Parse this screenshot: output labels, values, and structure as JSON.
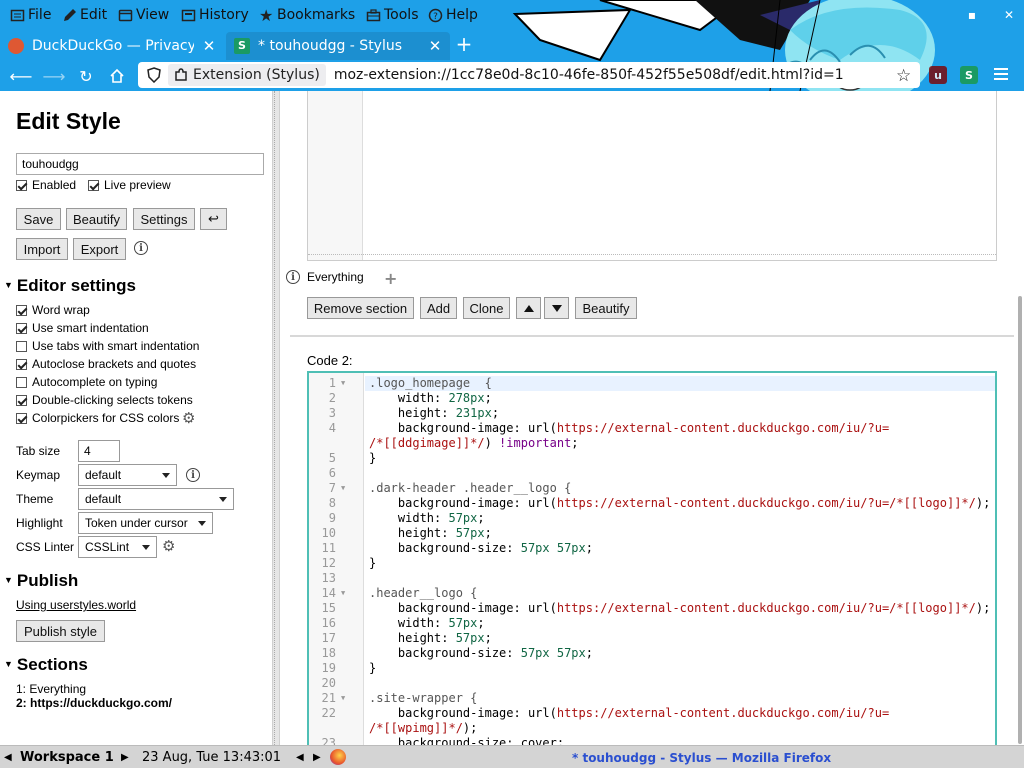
{
  "menubar": {
    "items": [
      "File",
      "Edit",
      "View",
      "History",
      "Bookmarks",
      "Tools",
      "Help"
    ]
  },
  "tabs": [
    {
      "title": "DuckDuckGo — Privacy, simplified.",
      "active": false
    },
    {
      "title": "* touhoudgg - Stylus",
      "active": true
    }
  ],
  "nav": {
    "identity_label": "Extension (Stylus)",
    "url": "moz-extension://1cc78e0d-8c10-46fe-850f-452f55e508df/edit.html?id=1"
  },
  "sidebar": {
    "title": "Edit Style",
    "style_name": "touhoudgg",
    "enabled_label": "Enabled",
    "live_preview_label": "Live preview",
    "buttons": {
      "save": "Save",
      "beautify": "Beautify",
      "settings": "Settings",
      "undo": "↩",
      "import": "Import",
      "export": "Export"
    },
    "editor_settings": {
      "heading": "Editor settings",
      "options": [
        {
          "label": "Word wrap",
          "checked": true
        },
        {
          "label": "Use smart indentation",
          "checked": true
        },
        {
          "label": "Use tabs with smart indentation",
          "checked": false
        },
        {
          "label": "Autoclose brackets and quotes",
          "checked": true
        },
        {
          "label": "Autocomplete on typing",
          "checked": false
        },
        {
          "label": "Double-clicking selects tokens",
          "checked": true
        },
        {
          "label": "Colorpickers for CSS colors",
          "checked": true
        }
      ],
      "tab_size_label": "Tab size",
      "tab_size": "4",
      "keymap_label": "Keymap",
      "keymap": "default",
      "theme_label": "Theme",
      "theme": "default",
      "highlight_label": "Highlight",
      "highlight": "Token under cursor",
      "linter_label": "CSS Linter",
      "linter": "CSSLint"
    },
    "publish": {
      "heading": "Publish",
      "link": "Using userstyles.world",
      "button": "Publish style"
    },
    "sections": {
      "heading": "Sections",
      "items": [
        "1: Everything",
        "2: https://duckduckgo.com/"
      ]
    }
  },
  "main": {
    "applies_to": "Everything",
    "section_buttons": {
      "remove": "Remove section",
      "add": "Add",
      "clone": "Clone",
      "beautify": "Beautify"
    },
    "code_label": "Code 2:",
    "code_lines": [
      {
        "n": "1",
        "fold": true,
        "parts": [
          [
            "sel",
            ".logo_homepage  {"
          ]
        ]
      },
      {
        "n": "2",
        "fold": false,
        "parts": [
          [
            "",
            "    width: "
          ],
          [
            "n",
            "278px"
          ],
          [
            "",
            ";"
          ]
        ]
      },
      {
        "n": "3",
        "fold": false,
        "parts": [
          [
            "",
            "    height: "
          ],
          [
            "n",
            "231px"
          ],
          [
            "",
            ";"
          ]
        ]
      },
      {
        "n": "4",
        "fold": false,
        "parts": [
          [
            "",
            "    background-image: url("
          ],
          [
            "s",
            "https://external-content.duckduckgo.com/iu/?u="
          ]
        ]
      },
      {
        "n": "",
        "fold": false,
        "parts": [
          [
            "s",
            "/*[[ddgimage]]*/"
          ],
          [
            "",
            ") "
          ],
          [
            "k",
            "!important"
          ],
          [
            "",
            ";"
          ]
        ]
      },
      {
        "n": "5",
        "fold": false,
        "parts": [
          [
            "",
            "}"
          ]
        ]
      },
      {
        "n": "6",
        "fold": false,
        "parts": [
          [
            "",
            ""
          ]
        ]
      },
      {
        "n": "7",
        "fold": true,
        "parts": [
          [
            "sel",
            ".dark-header .header__logo {"
          ]
        ]
      },
      {
        "n": "8",
        "fold": false,
        "parts": [
          [
            "",
            "    background-image: url("
          ],
          [
            "s",
            "https://external-content.duckduckgo.com/iu/?u=/*[[logo]]*/"
          ],
          [
            "",
            ");"
          ]
        ]
      },
      {
        "n": "9",
        "fold": false,
        "parts": [
          [
            "",
            "    width: "
          ],
          [
            "n",
            "57px"
          ],
          [
            "",
            ";"
          ]
        ]
      },
      {
        "n": "10",
        "fold": false,
        "parts": [
          [
            "",
            "    height: "
          ],
          [
            "n",
            "57px"
          ],
          [
            "",
            ";"
          ]
        ]
      },
      {
        "n": "11",
        "fold": false,
        "parts": [
          [
            "",
            "    background-size: "
          ],
          [
            "n",
            "57px 57px"
          ],
          [
            "",
            ";"
          ]
        ]
      },
      {
        "n": "12",
        "fold": false,
        "parts": [
          [
            "",
            "}"
          ]
        ]
      },
      {
        "n": "13",
        "fold": false,
        "parts": [
          [
            "",
            ""
          ]
        ]
      },
      {
        "n": "14",
        "fold": true,
        "parts": [
          [
            "sel",
            ".header__logo {"
          ]
        ]
      },
      {
        "n": "15",
        "fold": false,
        "parts": [
          [
            "",
            "    background-image: url("
          ],
          [
            "s",
            "https://external-content.duckduckgo.com/iu/?u=/*[[logo]]*/"
          ],
          [
            "",
            ");"
          ]
        ]
      },
      {
        "n": "16",
        "fold": false,
        "parts": [
          [
            "",
            "    width: "
          ],
          [
            "n",
            "57px"
          ],
          [
            "",
            ";"
          ]
        ]
      },
      {
        "n": "17",
        "fold": false,
        "parts": [
          [
            "",
            "    height: "
          ],
          [
            "n",
            "57px"
          ],
          [
            "",
            ";"
          ]
        ]
      },
      {
        "n": "18",
        "fold": false,
        "parts": [
          [
            "",
            "    background-size: "
          ],
          [
            "n",
            "57px 57px"
          ],
          [
            "",
            ";"
          ]
        ]
      },
      {
        "n": "19",
        "fold": false,
        "parts": [
          [
            "",
            "}"
          ]
        ]
      },
      {
        "n": "20",
        "fold": false,
        "parts": [
          [
            "",
            ""
          ]
        ]
      },
      {
        "n": "21",
        "fold": true,
        "parts": [
          [
            "sel",
            ".site-wrapper {"
          ]
        ]
      },
      {
        "n": "22",
        "fold": false,
        "parts": [
          [
            "",
            "    background-image: url("
          ],
          [
            "s",
            "https://external-content.duckduckgo.com/iu/?u="
          ]
        ]
      },
      {
        "n": "",
        "fold": false,
        "parts": [
          [
            "s",
            "/*[[wpimg]]*/"
          ],
          [
            "",
            ");"
          ]
        ]
      },
      {
        "n": "23",
        "fold": false,
        "parts": [
          [
            "",
            "    background-size: cover;"
          ]
        ]
      }
    ]
  },
  "taskbar": {
    "workspace": "Workspace 1",
    "datetime": "23 Aug, Tue 13:43:01",
    "window_title": "* touhoudgg - Stylus — Mozilla Firefox"
  },
  "colors": {
    "chrome_bg": "#1ea0e8",
    "editor_border": "#4fbfb5",
    "string": "#aa1111",
    "number": "#116644",
    "keyword": "#770088"
  }
}
